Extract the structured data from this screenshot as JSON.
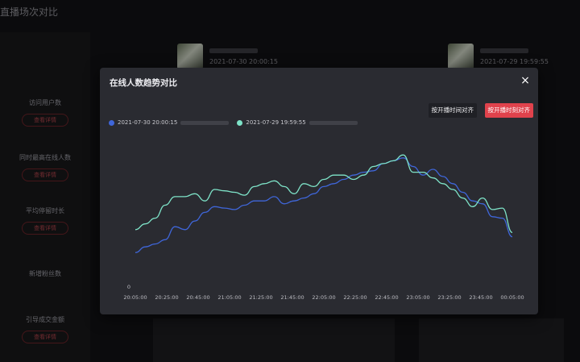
{
  "page": {
    "title": "直播场次对比",
    "metrics": [
      {
        "label": "访问用户数",
        "button": "查看详情"
      },
      {
        "label": "同时最高在线人数",
        "button": "查看详情"
      },
      {
        "label": "平均停留时长",
        "button": "查看详情"
      },
      {
        "label": "新增粉丝数",
        "button": ""
      },
      {
        "label": "引导成交金额",
        "button": "查看详情"
      }
    ],
    "sessions": [
      {
        "time": "2021-07-30 20:00:15"
      },
      {
        "time": "2021-07-29 19:59:55"
      }
    ]
  },
  "modal": {
    "title": "在线人数趋势对比",
    "close": "×",
    "align_by_time": "按开播时间对齐",
    "align_by_moment": "按开播时刻对齐",
    "legend": [
      {
        "label": "2021-07-30 20:00:15",
        "color": "#3f66d9"
      },
      {
        "label": "2021-07-29 19:59:55",
        "color": "#7ee3c8"
      }
    ]
  },
  "chart_data": {
    "type": "line",
    "x_ticks": [
      "20:05:00",
      "20:25:00",
      "20:45:00",
      "21:05:00",
      "21:25:00",
      "21:45:00",
      "22:05:00",
      "22:25:00",
      "22:45:00",
      "23:05:00",
      "23:25:00",
      "23:45:00",
      "00:05:00"
    ],
    "y_ticks": [
      "0",
      "",
      "",
      "",
      ""
    ],
    "ylim": [
      0,
      100
    ],
    "grid": false,
    "series": [
      {
        "name": "2021-07-30 20:00:15",
        "color": "#3f66d9",
        "values": [
          24,
          28,
          30,
          33,
          42,
          40,
          46,
          52,
          56,
          55,
          54,
          57,
          60,
          60,
          63,
          58,
          60,
          62,
          65,
          70,
          72,
          75,
          78,
          80,
          81,
          86,
          88,
          90,
          84,
          78,
          82,
          77,
          72,
          66,
          60,
          58,
          49,
          48,
          35
        ]
      },
      {
        "name": "2021-07-29 19:59:55",
        "color": "#7ee3c8",
        "values": [
          40,
          44,
          48,
          57,
          63,
          63,
          65,
          60,
          68,
          67,
          66,
          64,
          70,
          72,
          74,
          70,
          65,
          72,
          70,
          75,
          78,
          78,
          75,
          78,
          84,
          86,
          88,
          92,
          80,
          80,
          76,
          72,
          68,
          62,
          56,
          62,
          54,
          55,
          38
        ]
      }
    ]
  }
}
